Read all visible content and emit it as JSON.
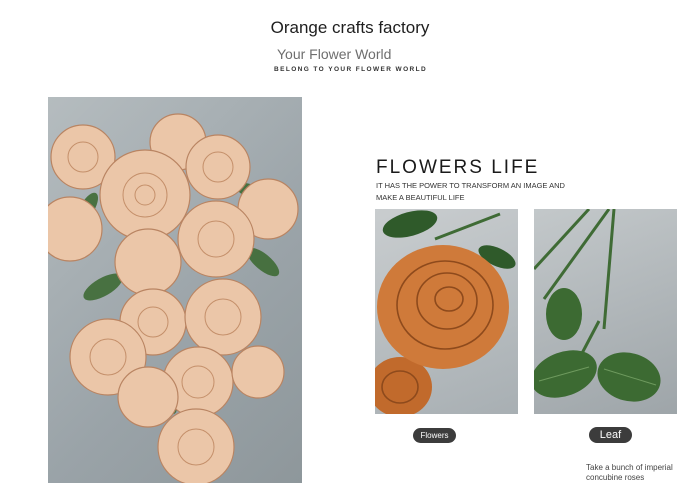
{
  "brand": {
    "title": "Orange crafts factory",
    "subtitle": "Your Flower World",
    "tagline": "BELONG TO YOUR FLOWER WORLD"
  },
  "feature": {
    "headline": "FLOWERS LIFE",
    "subheadline": "IT HAS THE POWER TO TRANSFORM AN IMAGE AND MAKE A BEAUTIFUL LIFE"
  },
  "details": [
    {
      "label": "Flowers",
      "icon": "rose-closeup-photo"
    },
    {
      "label": "Leaf",
      "icon": "leaf-closeup-photo"
    }
  ],
  "caption": "Take a bunch of imperial concubine roses",
  "colors": {
    "rose": "#e9c2a4",
    "rose_deep": "#c9753a",
    "leaf": "#3f6b35",
    "pill": "#3c3c3c",
    "background": "#ffffff"
  }
}
